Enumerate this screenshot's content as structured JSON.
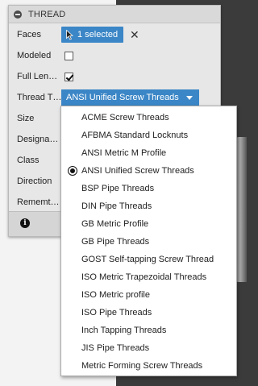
{
  "panel": {
    "title": "THREAD",
    "faces": {
      "label": "Faces",
      "value": "1 selected"
    },
    "modeled": {
      "label": "Modeled",
      "checked": false
    },
    "full_length": {
      "label": "Full Len…",
      "checked": true
    },
    "thread_type": {
      "label": "Thread T…",
      "value": "ANSI Unified Screw Threads"
    },
    "size": {
      "label": "Size"
    },
    "designation": {
      "label": "Designa…"
    },
    "class": {
      "label": "Class"
    },
    "direction": {
      "label": "Direction"
    },
    "remember": {
      "label": "Rememt…"
    }
  },
  "dropdown_options": [
    "ACME Screw Threads",
    "AFBMA Standard Locknuts",
    "ANSI Metric M Profile",
    "ANSI Unified Screw Threads",
    "BSP Pipe Threads",
    "DIN Pipe Threads",
    "GB Metric Profile",
    "GB Pipe Threads",
    "GOST Self-tapping Screw Thread",
    "ISO Metric Trapezoidal Threads",
    "ISO Metric profile",
    "ISO Pipe Threads",
    "Inch Tapping Threads",
    "JIS Pipe Threads",
    "Metric Forming Screw Threads"
  ],
  "selected_option": "ANSI Unified Screw Threads",
  "icons": {
    "collapse": "collapse-icon",
    "cursor": "cursor-icon",
    "clear": "close-icon",
    "caret": "chevron-down-icon",
    "info": "info-icon",
    "radio": "radio-selected-icon"
  }
}
